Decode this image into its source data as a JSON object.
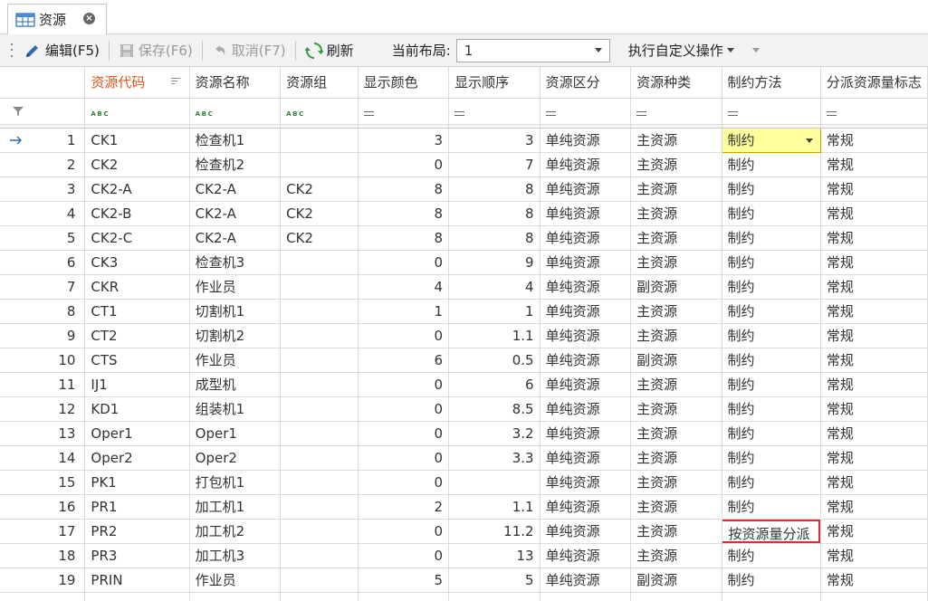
{
  "tab": {
    "title": "资源"
  },
  "toolbar": {
    "edit": "编辑(F5)",
    "save": "保存(F6)",
    "cancel": "取消(F7)",
    "refresh": "刷新",
    "layout_label": "当前布局:",
    "layout_value": "1",
    "custom_op": "执行自定义操作"
  },
  "columns": [
    "资源代码",
    "资源名称",
    "资源组",
    "显示颜色",
    "显示顺序",
    "资源区分",
    "资源种类",
    "制约方法",
    "分派资源量标志"
  ],
  "current_row": 1,
  "rows": [
    {
      "n": "1",
      "code": "CK1",
      "name": "检查机1",
      "group": "",
      "color": "3",
      "order": "3",
      "div": "单纯资源",
      "kind": "主资源",
      "method": "制约",
      "flag": "常规"
    },
    {
      "n": "2",
      "code": "CK2",
      "name": "检查机2",
      "group": "",
      "color": "0",
      "order": "7",
      "div": "单纯资源",
      "kind": "主资源",
      "method": "制约",
      "flag": "常规"
    },
    {
      "n": "3",
      "code": "CK2-A",
      "name": "CK2-A",
      "group": "CK2",
      "color": "8",
      "order": "8",
      "div": "单纯资源",
      "kind": "主资源",
      "method": "制约",
      "flag": "常规"
    },
    {
      "n": "4",
      "code": "CK2-B",
      "name": "CK2-A",
      "group": "CK2",
      "color": "8",
      "order": "8",
      "div": "单纯资源",
      "kind": "主资源",
      "method": "制约",
      "flag": "常规"
    },
    {
      "n": "5",
      "code": "CK2-C",
      "name": "CK2-A",
      "group": "CK2",
      "color": "8",
      "order": "8",
      "div": "单纯资源",
      "kind": "主资源",
      "method": "制约",
      "flag": "常规"
    },
    {
      "n": "6",
      "code": "CK3",
      "name": "检查机3",
      "group": "",
      "color": "0",
      "order": "9",
      "div": "单纯资源",
      "kind": "主资源",
      "method": "制约",
      "flag": "常规"
    },
    {
      "n": "7",
      "code": "CKR",
      "name": "作业员",
      "group": "",
      "color": "4",
      "order": "4",
      "div": "单纯资源",
      "kind": "副资源",
      "method": "制约",
      "flag": "常规"
    },
    {
      "n": "8",
      "code": "CT1",
      "name": "切割机1",
      "group": "",
      "color": "1",
      "order": "1",
      "div": "单纯资源",
      "kind": "主资源",
      "method": "制约",
      "flag": "常规"
    },
    {
      "n": "9",
      "code": "CT2",
      "name": "切割机2",
      "group": "",
      "color": "0",
      "order": "1.1",
      "div": "单纯资源",
      "kind": "主资源",
      "method": "制约",
      "flag": "常规"
    },
    {
      "n": "10",
      "code": "CTS",
      "name": "作业员",
      "group": "",
      "color": "6",
      "order": "0.5",
      "div": "单纯资源",
      "kind": "副资源",
      "method": "制约",
      "flag": "常规"
    },
    {
      "n": "11",
      "code": "IJ1",
      "name": "成型机",
      "group": "",
      "color": "0",
      "order": "6",
      "div": "单纯资源",
      "kind": "主资源",
      "method": "制约",
      "flag": "常规"
    },
    {
      "n": "12",
      "code": "KD1",
      "name": "组装机1",
      "group": "",
      "color": "0",
      "order": "8.5",
      "div": "单纯资源",
      "kind": "主资源",
      "method": "制约",
      "flag": "常规"
    },
    {
      "n": "13",
      "code": "Oper1",
      "name": "Oper1",
      "group": "",
      "color": "0",
      "order": "3.2",
      "div": "单纯资源",
      "kind": "主资源",
      "method": "制约",
      "flag": "常规"
    },
    {
      "n": "14",
      "code": "Oper2",
      "name": "Oper2",
      "group": "",
      "color": "0",
      "order": "3.3",
      "div": "单纯资源",
      "kind": "主资源",
      "method": "制约",
      "flag": "常规"
    },
    {
      "n": "15",
      "code": "PK1",
      "name": "打包机1",
      "group": "",
      "color": "0",
      "order": "",
      "div": "单纯资源",
      "kind": "主资源",
      "method": "制约",
      "flag": "常规"
    },
    {
      "n": "16",
      "code": "PR1",
      "name": "加工机1",
      "group": "",
      "color": "2",
      "order": "1.1",
      "div": "单纯资源",
      "kind": "主资源",
      "method": "制约",
      "flag": "常规"
    },
    {
      "n": "17",
      "code": "PR2",
      "name": "加工机2",
      "group": "",
      "color": "0",
      "order": "11.2",
      "div": "单纯资源",
      "kind": "主资源",
      "method": "按资源量分派",
      "flag": "常规"
    },
    {
      "n": "18",
      "code": "PR3",
      "name": "加工机3",
      "group": "",
      "color": "0",
      "order": "13",
      "div": "单纯资源",
      "kind": "主资源",
      "method": "制约",
      "flag": "常规"
    },
    {
      "n": "19",
      "code": "PRIN",
      "name": "作业员",
      "group": "",
      "color": "5",
      "order": "5",
      "div": "单纯资源",
      "kind": "副资源",
      "method": "制约",
      "flag": "常规"
    }
  ],
  "colors": {
    "accent_header": "#e0561e",
    "selected_cell": "#ffff9e",
    "highlight_border": "#e02d2d"
  }
}
